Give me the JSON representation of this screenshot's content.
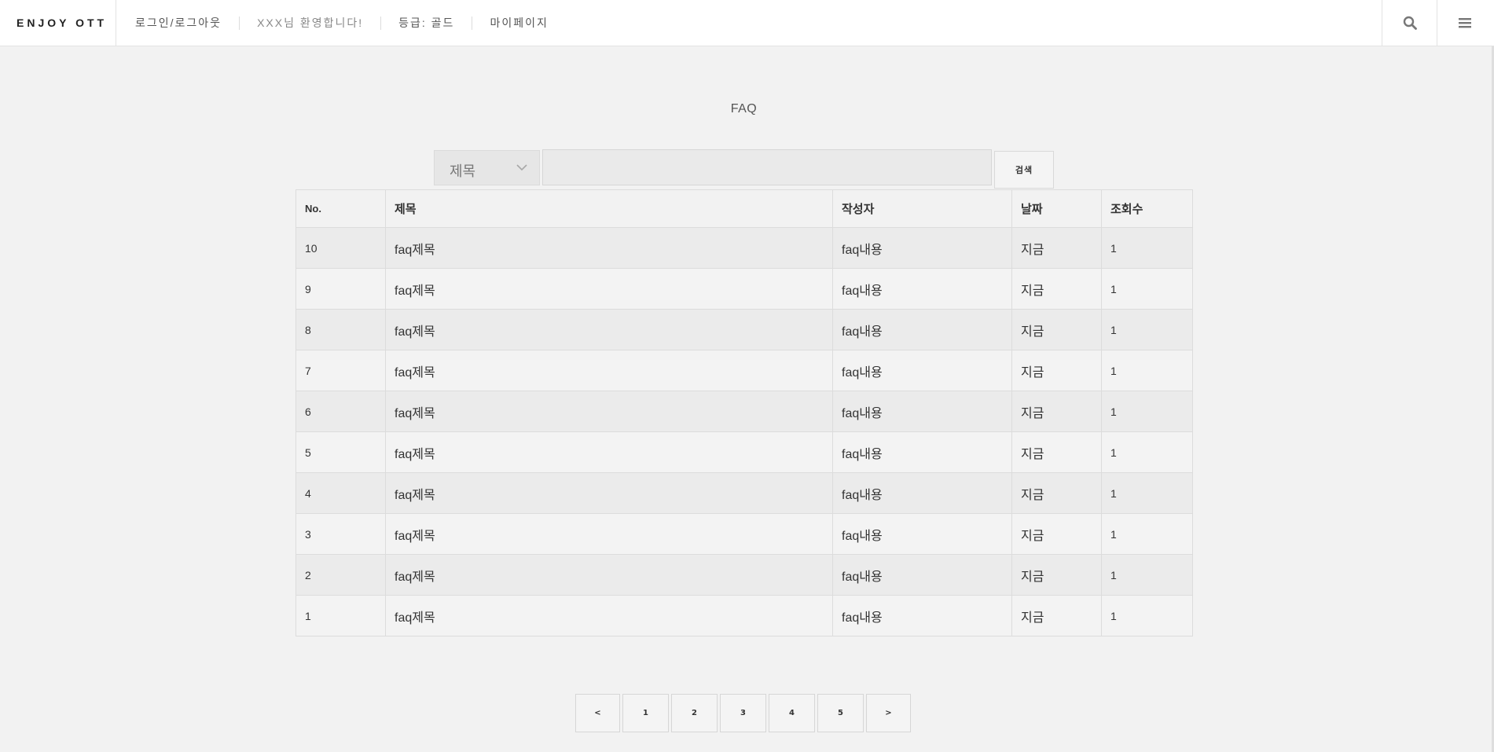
{
  "header": {
    "brand": "ENJOY OTT",
    "links": [
      {
        "label": "로그인/로그아웃"
      },
      {
        "label": "XXX님 환영합니다!"
      },
      {
        "label": "등급: 골드"
      },
      {
        "label": "마이페이지"
      }
    ],
    "icons": [
      "search-icon",
      "menu-icon"
    ]
  },
  "page": {
    "title": "FAQ"
  },
  "search": {
    "field_selected": "제목",
    "query": "",
    "button_label": "검색"
  },
  "table": {
    "columns": [
      "No.",
      "제목",
      "작성자",
      "날짜",
      "조회수"
    ],
    "rows": [
      {
        "no": "10",
        "title": "faq제목",
        "writer": "faq내용",
        "date": "지금",
        "views": "1"
      },
      {
        "no": "9",
        "title": "faq제목",
        "writer": "faq내용",
        "date": "지금",
        "views": "1"
      },
      {
        "no": "8",
        "title": "faq제목",
        "writer": "faq내용",
        "date": "지금",
        "views": "1"
      },
      {
        "no": "7",
        "title": "faq제목",
        "writer": "faq내용",
        "date": "지금",
        "views": "1"
      },
      {
        "no": "6",
        "title": "faq제목",
        "writer": "faq내용",
        "date": "지금",
        "views": "1"
      },
      {
        "no": "5",
        "title": "faq제목",
        "writer": "faq내용",
        "date": "지금",
        "views": "1"
      },
      {
        "no": "4",
        "title": "faq제목",
        "writer": "faq내용",
        "date": "지금",
        "views": "1"
      },
      {
        "no": "3",
        "title": "faq제목",
        "writer": "faq내용",
        "date": "지금",
        "views": "1"
      },
      {
        "no": "2",
        "title": "faq제목",
        "writer": "faq내용",
        "date": "지금",
        "views": "1"
      },
      {
        "no": "1",
        "title": "faq제목",
        "writer": "faq내용",
        "date": "지금",
        "views": "1"
      }
    ]
  },
  "pagination": {
    "prev": "<",
    "pages": [
      "1",
      "2",
      "3",
      "4",
      "5"
    ],
    "next": ">"
  }
}
